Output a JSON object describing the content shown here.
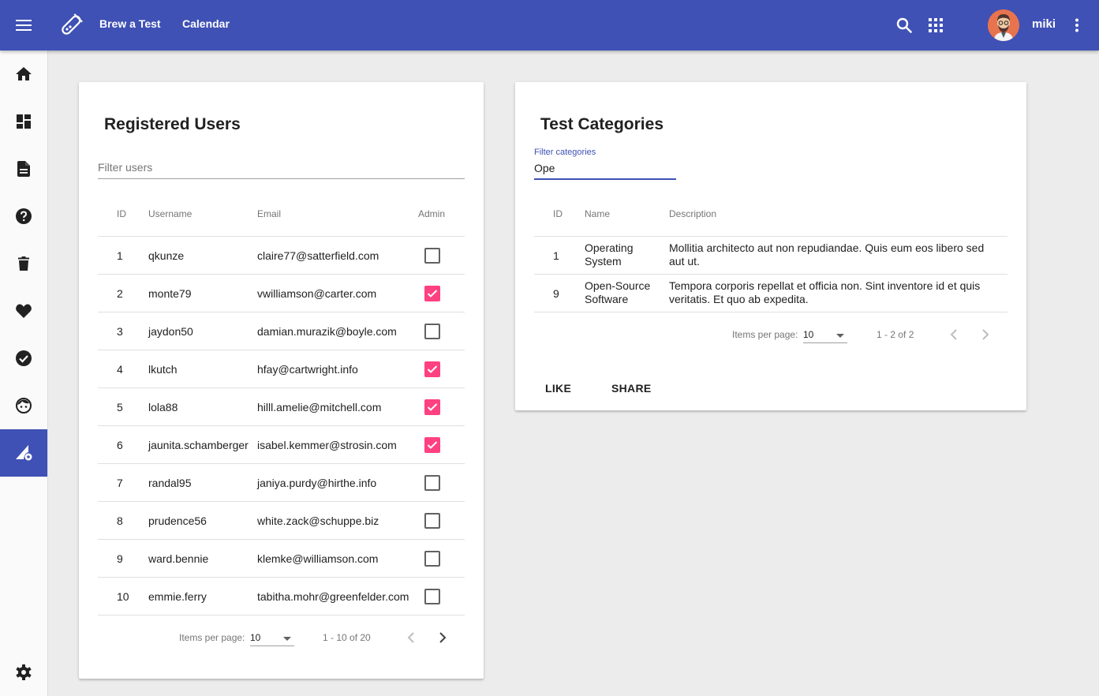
{
  "toolbar": {
    "brew_label": "Brew a Test",
    "calendar_label": "Calendar",
    "user_name": "miki",
    "icons": {
      "menu": "menu-icon",
      "logo": "test-tube-icon",
      "search": "search-icon",
      "apps": "apps-icon",
      "more": "more-vert-icon"
    }
  },
  "sidebar": {
    "items": [
      {
        "icon": "home-icon",
        "active": false
      },
      {
        "icon": "dashboard-icon",
        "active": false
      },
      {
        "icon": "document-icon",
        "active": false
      },
      {
        "icon": "help-icon",
        "active": false
      },
      {
        "icon": "delete-icon",
        "active": false
      },
      {
        "icon": "favorite-icon",
        "active": false
      },
      {
        "icon": "check-circle-icon",
        "active": false
      },
      {
        "icon": "face-icon",
        "active": false
      },
      {
        "icon": "network-settings-icon",
        "active": true
      }
    ],
    "bottom_icon": "settings-icon"
  },
  "users": {
    "title": "Registered Users",
    "filter_placeholder": "Filter users",
    "filter_value": "",
    "columns": {
      "id": "ID",
      "username": "Username",
      "email": "Email",
      "admin": "Admin"
    },
    "rows": [
      {
        "id": "1",
        "username": "qkunze",
        "email": "claire77@satterfield.com",
        "admin": false
      },
      {
        "id": "2",
        "username": "monte79",
        "email": "vwilliamson@carter.com",
        "admin": true
      },
      {
        "id": "3",
        "username": "jaydon50",
        "email": "damian.murazik@boyle.com",
        "admin": false
      },
      {
        "id": "4",
        "username": "lkutch",
        "email": "hfay@cartwright.info",
        "admin": true
      },
      {
        "id": "5",
        "username": "lola88",
        "email": "hilll.amelie@mitchell.com",
        "admin": true
      },
      {
        "id": "6",
        "username": "jaunita.schamberger",
        "email": "isabel.kemmer@strosin.com",
        "admin": true
      },
      {
        "id": "7",
        "username": "randal95",
        "email": "janiya.purdy@hirthe.info",
        "admin": false
      },
      {
        "id": "8",
        "username": "prudence56",
        "email": "white.zack@schuppe.biz",
        "admin": false
      },
      {
        "id": "9",
        "username": "ward.bennie",
        "email": "klemke@williamson.com",
        "admin": false
      },
      {
        "id": "10",
        "username": "emmie.ferry",
        "email": "tabitha.mohr@greenfelder.com",
        "admin": false
      }
    ],
    "paginator": {
      "items_per_page_label": "Items per page:",
      "page_size": "10",
      "range": "1 - 10 of 20"
    }
  },
  "categories": {
    "title": "Test Categories",
    "filter_label": "Filter categories",
    "filter_value": "Ope",
    "columns": {
      "id": "ID",
      "name": "Name",
      "description": "Description"
    },
    "rows": [
      {
        "id": "1",
        "name": "Operating System",
        "description": "Mollitia architecto aut non repudiandae. Quis eum eos libero sed aut ut."
      },
      {
        "id": "9",
        "name": "Open-Source Software",
        "description": "Tempora corporis repellat et officia non. Sint inventore id et quis veritatis. Et quo ab expedita."
      }
    ],
    "paginator": {
      "items_per_page_label": "Items per page:",
      "page_size": "10",
      "range": "1 - 2 of 2"
    },
    "actions": {
      "like": "LIKE",
      "share": "SHARE"
    }
  },
  "colors": {
    "primary": "#3f51b5",
    "accent": "#ff4081",
    "background": "#ececec"
  }
}
